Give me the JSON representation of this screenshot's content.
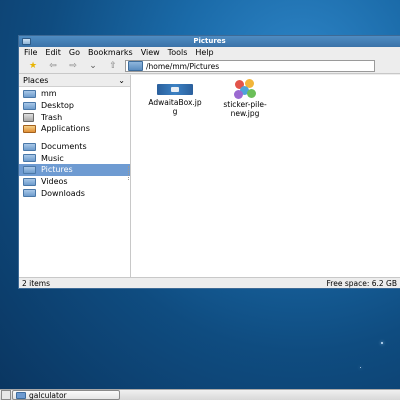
{
  "window": {
    "title": "Pictures"
  },
  "menu": [
    "File",
    "Edit",
    "Go",
    "Bookmarks",
    "View",
    "Tools",
    "Help"
  ],
  "toolbar": {
    "path": "/home/mm/Pictures",
    "icons": [
      "bookmark-star-icon",
      "back-arrow-icon",
      "forward-arrow-icon",
      "history-dropdown-icon",
      "up-arrow-icon",
      "folder-icon"
    ]
  },
  "sidebar": {
    "header": "Places",
    "items": [
      {
        "label": "mm",
        "icon": "home-folder-icon"
      },
      {
        "label": "Desktop",
        "icon": "desktop-folder-icon"
      },
      {
        "label": "Trash",
        "icon": "trash-icon"
      },
      {
        "label": "Applications",
        "icon": "applications-icon"
      },
      {
        "label": "Documents",
        "icon": "folder-icon"
      },
      {
        "label": "Music",
        "icon": "folder-icon"
      },
      {
        "label": "Pictures",
        "icon": "folder-icon",
        "selected": true
      },
      {
        "label": "Videos",
        "icon": "folder-icon"
      },
      {
        "label": "Downloads",
        "icon": "folder-icon"
      }
    ]
  },
  "files": [
    {
      "name_line1": "AdwaitaBox.jp",
      "name_line2": "g"
    },
    {
      "name_line1": "sticker-pile-",
      "name_line2": "new.jpg"
    }
  ],
  "status": {
    "items": "2 items",
    "free_space": "Free space: 6.2 GB"
  },
  "taskbar": {
    "items": [
      {
        "label": "galculator"
      }
    ]
  },
  "colors": {
    "selection": "#6e9bd2",
    "titlebar": "#3a72a8",
    "desktop": "#1a6aa8"
  }
}
